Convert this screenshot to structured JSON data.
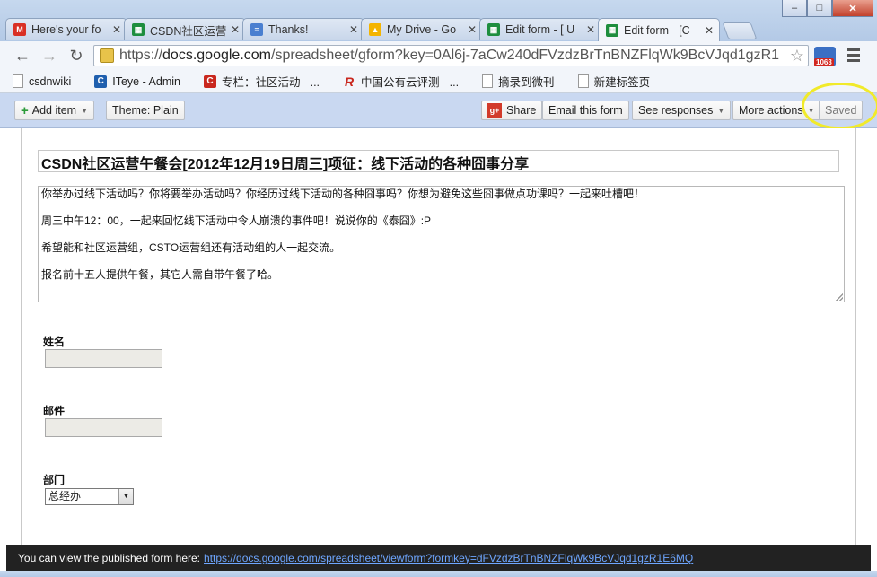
{
  "tabs": [
    {
      "title": "Here's your fo",
      "icon": "gmail-icon",
      "color": "#d93025"
    },
    {
      "title": "CSDN社区运营",
      "icon": "sheets-icon",
      "color": "#1e8e3e"
    },
    {
      "title": "Thanks!",
      "icon": "docs-icon",
      "color": "#4a7fd0"
    },
    {
      "title": "My Drive - Go",
      "icon": "drive-icon",
      "color": "#f4b400"
    },
    {
      "title": "Edit form - [ U",
      "icon": "sheets-icon",
      "color": "#1e8e3e"
    },
    {
      "title": "Edit form - [C",
      "icon": "sheets-icon",
      "color": "#1e8e3e"
    }
  ],
  "window_controls": {
    "minimize": "–",
    "maximize": "□",
    "close": "✕"
  },
  "nav": {
    "back": "←",
    "forward": "→",
    "reload": "↻"
  },
  "address": {
    "prefix": "https://",
    "host": "docs.google.com",
    "path": "/spreadsheet/gform?key=0Al6j-7aCw240dFVzdzBrTnBNZFlqWk9BcVJqd1gzR1"
  },
  "extension_badge": "1063",
  "bookmarks": [
    {
      "label": "csdnwiki",
      "icon": "page-icon"
    },
    {
      "label": "ITeye - Admin",
      "icon": "iteye-icon"
    },
    {
      "label": "专栏：社区活动 - ...",
      "icon": "csdn-icon"
    },
    {
      "label": "中国公有云评测 - ...",
      "icon": "r-icon"
    },
    {
      "label": "摘录到微刊",
      "icon": "page-icon"
    },
    {
      "label": "新建标签页",
      "icon": "page-icon"
    }
  ],
  "formbar": {
    "add_item": "Add item",
    "theme": "Theme:  Plain",
    "share": "Share",
    "email": "Email this form",
    "see_responses": "See responses",
    "more_actions": "More actions",
    "saved": "Saved"
  },
  "form": {
    "title": "CSDN社区运营午餐会[2012年12月19日周三]项征：线下活动的各种囧事分享",
    "description": [
      "你举办过线下活动吗？你将要举办活动吗？你经历过线下活动的各种囧事吗？你想为避免这些囧事做点功课吗？一起来吐槽吧！",
      "周三中午12：00，一起来回忆线下活动中令人崩溃的事件吧！说说你的《泰囧》:P",
      "希望能和社区运营组，CSTO运营组还有活动组的人一起交流。",
      "报名前十五人提供午餐，其它人需自带午餐了哈。"
    ],
    "questions": [
      {
        "label": "姓名",
        "value": ""
      },
      {
        "label": "邮件",
        "value": ""
      },
      {
        "label": "部门",
        "selected": "总经办"
      }
    ]
  },
  "status": {
    "text": "You can view the published form here:",
    "link": "https://docs.google.com/spreadsheet/viewform?formkey=dFVzdzBrTnBNZFlqWk9BcVJqd1gzR1E6MQ"
  }
}
